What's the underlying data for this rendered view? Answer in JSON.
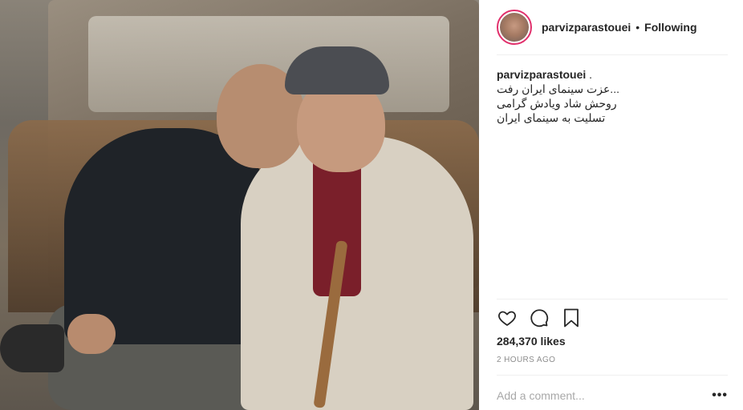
{
  "post": {
    "image_alt": "Two men embracing in front of a wrecked car"
  },
  "header": {
    "username": "parvizparastouei",
    "separator": "•",
    "follow_label": "Following"
  },
  "caption": {
    "author": "parvizparastouei",
    "author_suffix": " .",
    "lines": [
      "...عزت سینمای ایران رفت",
      "روحش شاد ویادش گرامی",
      "تسلیت به سینمای ایران"
    ]
  },
  "actions": {
    "like_icon": "heart-icon",
    "comment_icon": "comment-icon",
    "save_icon": "bookmark-icon"
  },
  "stats": {
    "likes_text": "284,370 likes",
    "time_text": "2 HOURS AGO"
  },
  "comment": {
    "placeholder": "Add a comment...",
    "more_label": "•••"
  },
  "colors": {
    "avatar_ring": "#e1306c",
    "text": "#262626",
    "muted": "#8e8e8e",
    "divider": "#efefef"
  }
}
